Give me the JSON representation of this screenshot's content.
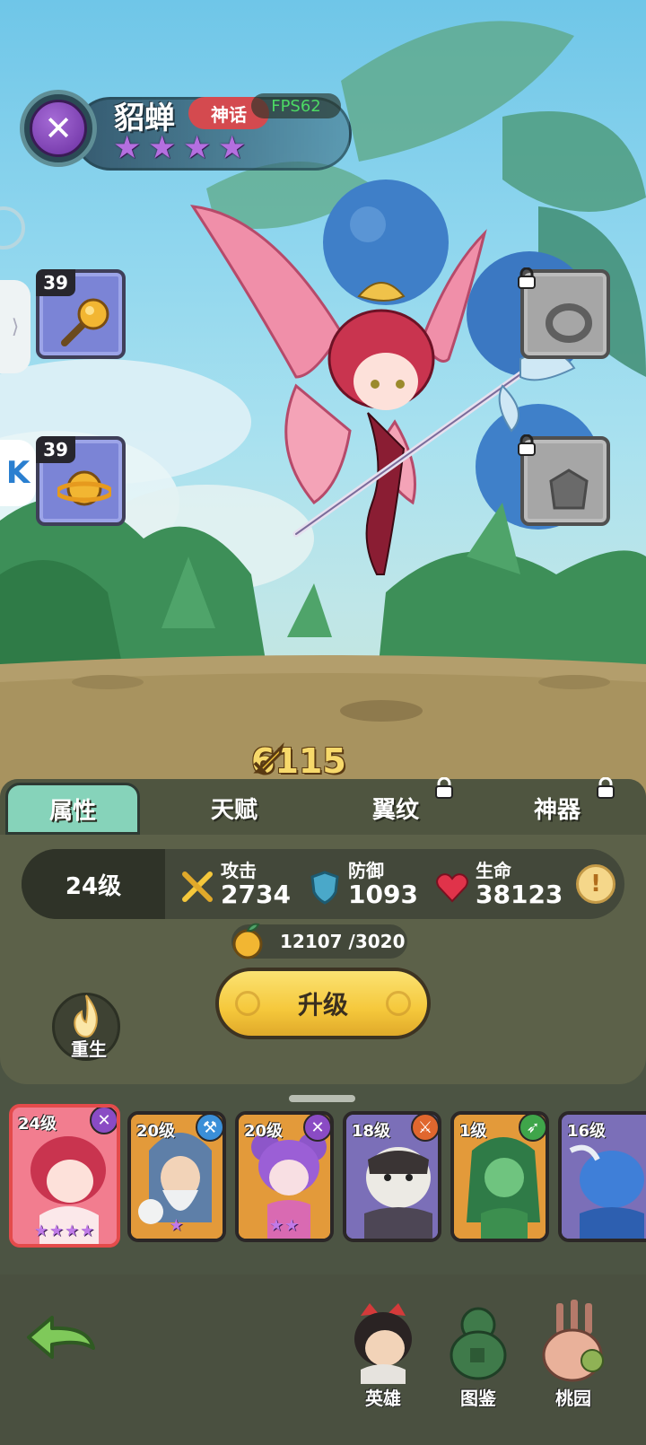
{
  "hero": {
    "name": "貂蝉",
    "rarity": "神话",
    "stars": "★★★★",
    "class_symbol": "✕"
  },
  "fps": "FPS62",
  "equipment": [
    {
      "level": "39",
      "name": "golden-scepter",
      "locked": false
    },
    {
      "level": "39",
      "name": "golden-ring-planet",
      "locked": false
    },
    {
      "level": "",
      "name": "ring-slot",
      "locked": true
    },
    {
      "level": "",
      "name": "armor-slot",
      "locked": true
    }
  ],
  "power": "6115",
  "tabs": {
    "attributes": "属性",
    "talent": "天赋",
    "wing_pattern": "翼纹",
    "artifact": "神器"
  },
  "stats": {
    "level": "24级",
    "attack_label": "攻击",
    "attack": "2734",
    "defense_label": "防御",
    "defense": "1093",
    "hp_label": "生命",
    "hp": "38123",
    "info": "!"
  },
  "upgrade_cost": "12107 /3020",
  "buttons": {
    "rebirth": "重生",
    "upgrade": "升级"
  },
  "hero_list": [
    {
      "level": "24级",
      "stars": "★★★★",
      "class_color": "#8a4bc4",
      "class_symbol": "✕"
    },
    {
      "level": "20级",
      "stars": "★",
      "class_color": "#3b8fd8",
      "class_symbol": "⚒"
    },
    {
      "level": "20级",
      "stars": "★★",
      "class_color": "#8a4bc4",
      "class_symbol": "✕"
    },
    {
      "level": "18级",
      "stars": "",
      "class_color": "#e0672e",
      "class_symbol": "⚔"
    },
    {
      "level": "1级",
      "stars": "",
      "class_color": "#3fa54a",
      "class_symbol": "➶"
    },
    {
      "level": "16级",
      "stars": "",
      "class_color": "#e0672e",
      "class_symbol": "⚔"
    }
  ],
  "nav": {
    "heroes": "英雄",
    "codex": "图鉴",
    "peach_garden": "桃园"
  },
  "colors": {
    "accent_gold": "#f5c83b",
    "rarity_red": "#d44a4f",
    "tab_active": "#86d3ba",
    "panel": "#5c6149"
  }
}
